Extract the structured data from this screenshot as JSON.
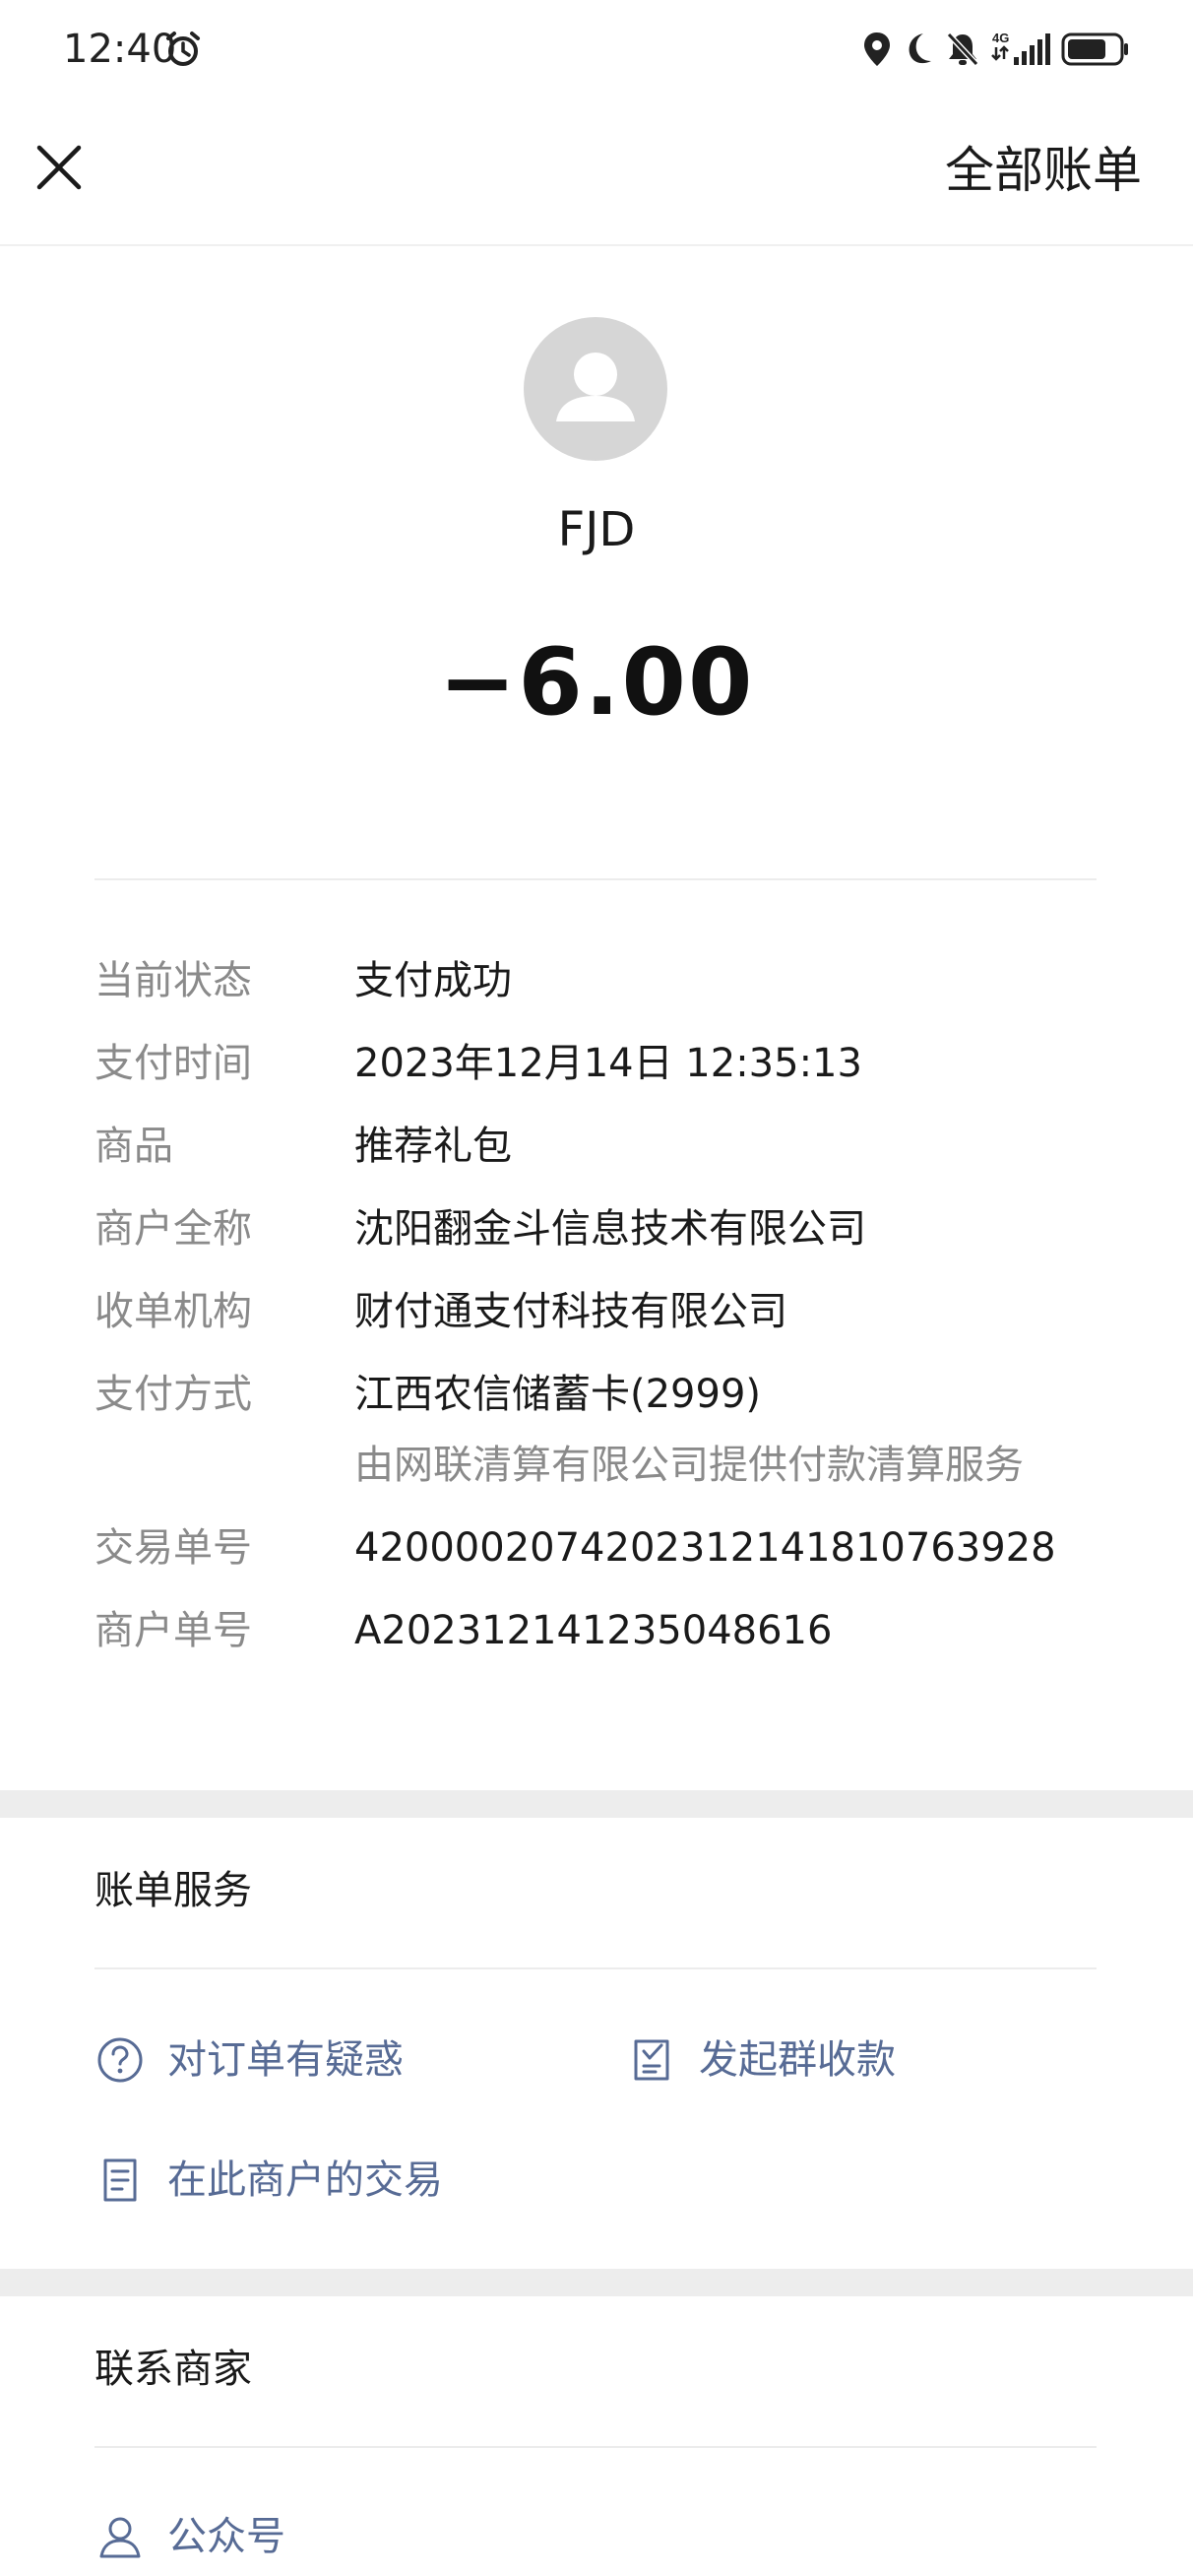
{
  "status_bar": {
    "time": "12:40",
    "network": "4G"
  },
  "header": {
    "close_icon": "close-icon",
    "right_link": "全部账单"
  },
  "payee": {
    "name": "FJD",
    "amount": "−6.00"
  },
  "details": [
    {
      "label": "当前状态",
      "value": "支付成功"
    },
    {
      "label": "支付时间",
      "value": "2023年12月14日 12:35:13"
    },
    {
      "label": "商品",
      "value": "推荐礼包"
    },
    {
      "label": "商户全称",
      "value": "沈阳翻金斗信息技术有限公司"
    },
    {
      "label": "收单机构",
      "value": "财付通支付科技有限公司"
    },
    {
      "label": "支付方式",
      "value": "江西农信储蓄卡(2999)",
      "sub": "由网联清算有限公司提供付款清算服务"
    },
    {
      "label": "交易单号",
      "value": "4200002074202312141810763928"
    },
    {
      "label": "商户单号",
      "value": "A202312141235048616"
    }
  ],
  "bill_services": {
    "title": "账单服务",
    "actions": [
      {
        "label": "对订单有疑惑",
        "icon": "question-circle-icon"
      },
      {
        "label": "发起群收款",
        "icon": "group-collect-icon"
      },
      {
        "label": "在此商户的交易",
        "icon": "document-icon"
      }
    ]
  },
  "contact_merchant": {
    "title": "联系商家",
    "actions": [
      {
        "label": "公众号",
        "icon": "user-icon"
      }
    ]
  },
  "colors": {
    "link": "#576b95",
    "label_gray": "#8a8a8a",
    "separator": "#ededed",
    "avatar_bg": "#d6d6d6"
  }
}
